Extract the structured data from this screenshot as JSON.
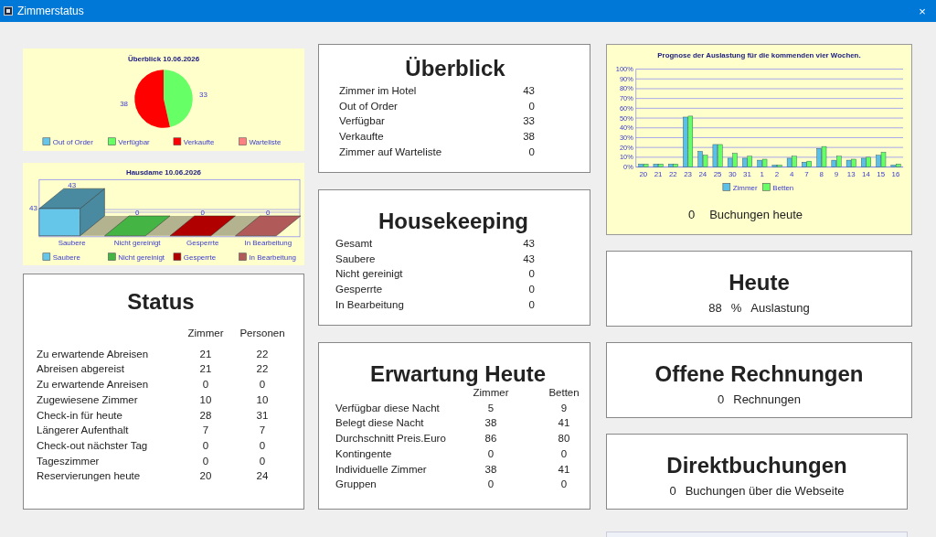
{
  "window": {
    "title": "Zimmerstatus",
    "close": "×"
  },
  "overview_chart": {
    "chart_data": {
      "type": "pie",
      "title": "Überblick  10.06.2026",
      "values": [
        0,
        33,
        38,
        0
      ],
      "data_labels": true
    },
    "legend": [
      {
        "label": "Out of Order",
        "color": "#66c6ea"
      },
      {
        "label": "Verfügbar",
        "color": "#66ff66"
      },
      {
        "label": "Verkaufte",
        "color": "#ff0000"
      },
      {
        "label": "Warteliste",
        "color": "#ff8080"
      }
    ]
  },
  "housekeeping_chart": {
    "title": "Hausdame  10.06.2026",
    "axis_max": "43",
    "bars": [
      {
        "label": "Saubere",
        "value": "43"
      },
      {
        "label": "Nicht gereinigt",
        "value": "0"
      },
      {
        "label": "Gesperrte",
        "value": "0"
      },
      {
        "label": "In Bearbeitung",
        "value": "0"
      }
    ],
    "legend": [
      {
        "label": "Saubere",
        "color": "#66c6ea"
      },
      {
        "label": "Nicht gereinigt",
        "color": "#44b444"
      },
      {
        "label": "Gesperrte",
        "color": "#b00000"
      },
      {
        "label": "In Bearbeitung",
        "color": "#b05a5a"
      }
    ]
  },
  "status": {
    "title": "Status",
    "columns": [
      "Zimmer",
      "Personen"
    ],
    "rows": [
      {
        "label": "Zu erwartende Abreisen",
        "values": [
          "21",
          "22"
        ]
      },
      {
        "label": "Abreisen abgereist",
        "values": [
          "21",
          "22"
        ]
      },
      {
        "label": "Zu erwartende Anreisen",
        "values": [
          "0",
          "0"
        ]
      },
      {
        "label": "Zugewiesene Zimmer",
        "values": [
          "10",
          "10"
        ]
      },
      {
        "label": "Check-in für heute",
        "values": [
          "28",
          "31"
        ]
      },
      {
        "label": "Längerer Aufenthalt",
        "values": [
          "7",
          "7"
        ]
      },
      {
        "label": "Check-out nächster Tag",
        "values": [
          "0",
          "0"
        ]
      },
      {
        "label": "Tageszimmer",
        "values": [
          "0",
          "0"
        ]
      },
      {
        "label": "Reservierungen heute",
        "values": [
          "20",
          "24"
        ]
      }
    ]
  },
  "overview": {
    "title": "Überblick",
    "rows": [
      {
        "label": "Zimmer im Hotel",
        "value": "43"
      },
      {
        "label": "Out of Order",
        "value": "0"
      },
      {
        "label": "Verfügbar",
        "value": "33"
      },
      {
        "label": "Verkaufte",
        "value": "38"
      },
      {
        "label": "Zimmer auf Warteliste",
        "value": "0"
      }
    ]
  },
  "housekeeping": {
    "title": "Housekeeping",
    "rows": [
      {
        "label": "Gesamt",
        "value": "43"
      },
      {
        "label": "Saubere",
        "value": "43"
      },
      {
        "label": "Nicht gereinigt",
        "value": "0"
      },
      {
        "label": "Gesperrte",
        "value": "0"
      },
      {
        "label": "In Bearbeitung",
        "value": "0"
      }
    ]
  },
  "expectation": {
    "title": "Erwartung Heute",
    "columns": [
      "Zimmer",
      "Betten"
    ],
    "rows": [
      {
        "label": "Verfügbar diese Nacht",
        "values": [
          "5",
          "9"
        ]
      },
      {
        "label": "Belegt diese Nacht",
        "values": [
          "38",
          "41"
        ]
      },
      {
        "label": "Durchschnitt Preis.Euro",
        "values": [
          "86",
          "80"
        ]
      },
      {
        "label": "Kontingente",
        "values": [
          "0",
          "0"
        ]
      },
      {
        "label": "Individuelle Zimmer",
        "values": [
          "38",
          "41"
        ]
      },
      {
        "label": "Gruppen",
        "values": [
          "0",
          "0"
        ]
      }
    ]
  },
  "forecast": {
    "chart_data": {
      "type": "bar",
      "title": "Prognose der Auslastung für die kommenden vier Wochen.",
      "categories": [
        "20",
        "21",
        "22",
        "23",
        "24",
        "25",
        "30",
        "31",
        "1",
        "2",
        "4",
        "7",
        "8",
        "9",
        "13",
        "14",
        "15",
        "16"
      ],
      "ylim": [
        0,
        100
      ],
      "grid": true,
      "legend": "bottom",
      "yticks": [
        {
          "value": 0,
          "label": "0%"
        },
        {
          "value": 10,
          "label": "10%"
        },
        {
          "value": 20,
          "label": "20%"
        },
        {
          "value": 30,
          "label": "30%"
        },
        {
          "value": 40,
          "label": "40%"
        },
        {
          "value": 50,
          "label": "50%"
        },
        {
          "value": 60,
          "label": "60%"
        },
        {
          "value": 70,
          "label": "70%"
        },
        {
          "value": 80,
          "label": "80%"
        },
        {
          "value": 90,
          "label": "90%"
        },
        {
          "value": 100,
          "label": "100%"
        }
      ],
      "series": [
        {
          "name": "Zimmer",
          "color": "#5bc0e8",
          "values": [
            3,
            3,
            3,
            51,
            16,
            23,
            9,
            9,
            7,
            2,
            9,
            5,
            19,
            7,
            7,
            9,
            12,
            2
          ]
        },
        {
          "name": "Betten",
          "color": "#66ff66",
          "values": [
            3,
            3,
            3,
            52,
            12,
            23,
            14,
            11,
            8,
            2,
            11,
            6,
            21,
            11,
            8,
            10,
            15,
            3
          ]
        }
      ]
    },
    "value": "0",
    "text": "Buchungen heute"
  },
  "today": {
    "title": "Heute",
    "value": "88",
    "unit": "%",
    "text": "Auslastung"
  },
  "invoices": {
    "title": "Offene Rechnungen",
    "value": "0",
    "text": "Rechnungen"
  },
  "direct": {
    "title": "Direktbuchungen",
    "value": "0",
    "text": "Buchungen über die Webseite"
  }
}
